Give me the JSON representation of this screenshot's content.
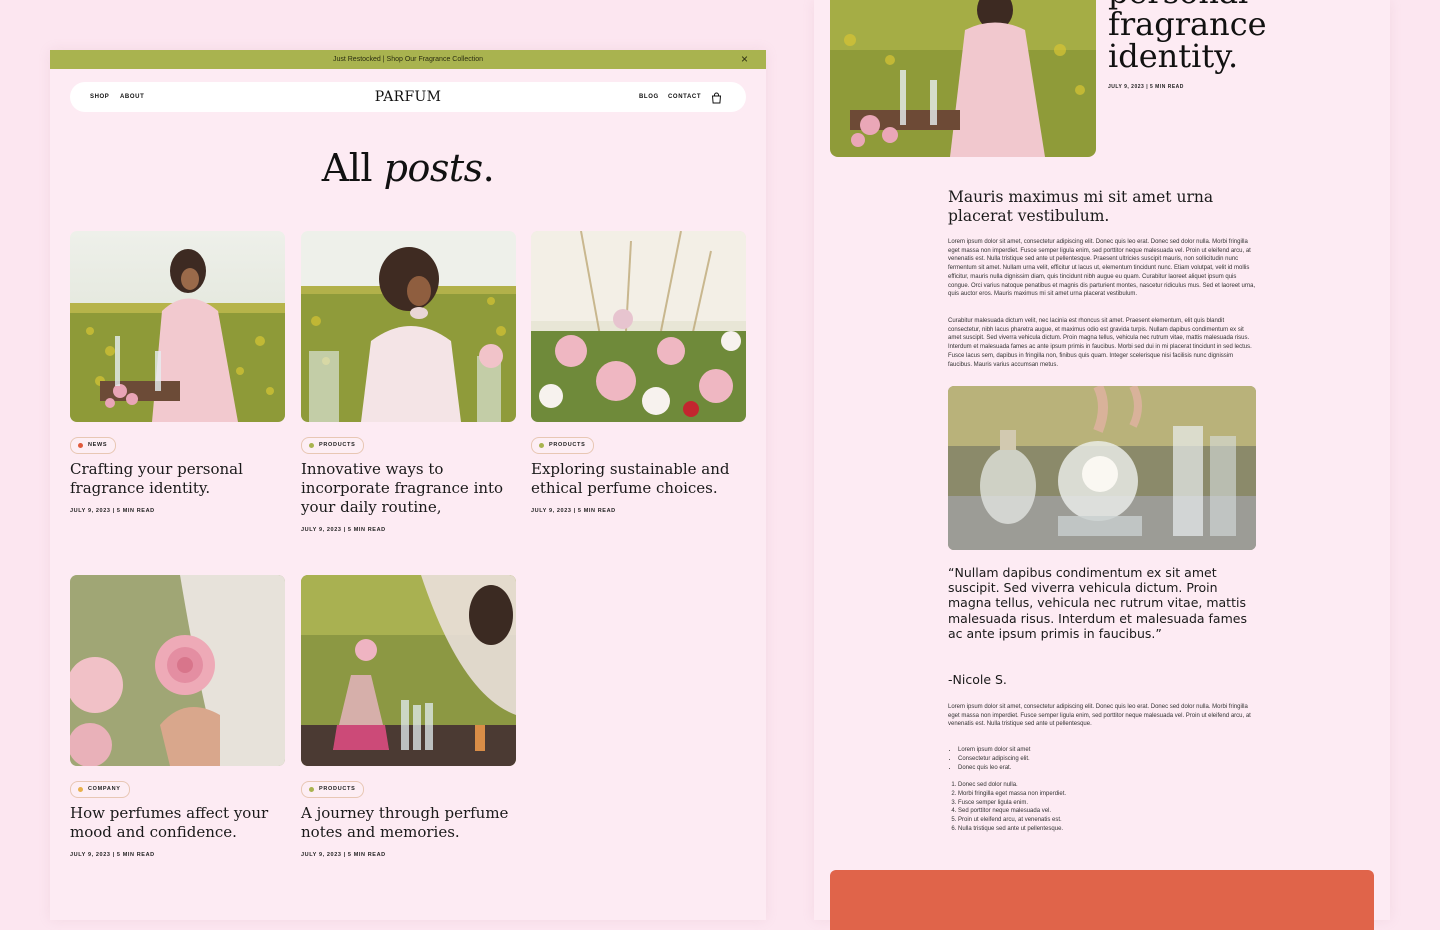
{
  "announcement": {
    "text": "Just Restocked | Shop Our Fragrance Collection",
    "close_icon": "×"
  },
  "nav": {
    "shop": "SHOP",
    "about": "ABOUT",
    "logo": "PARFUM",
    "blog": "BLOG",
    "contact": "CONTACT",
    "cart_icon": "shopping-bag"
  },
  "page_title": {
    "regular": "All ",
    "italic": "posts",
    "end": "."
  },
  "posts": [
    {
      "tag": "NEWS",
      "tag_color": "#e05a3c",
      "title": "Crafting your personal fragrance identity.",
      "meta": "JULY 9, 2023 | 5 MIN READ"
    },
    {
      "tag": "PRODUCTS",
      "tag_color": "#a9b34f",
      "title": "Innovative ways to incorporate fragrance into your daily routine,",
      "meta": "JULY 9, 2023 | 5 MIN READ"
    },
    {
      "tag": "PRODUCTS",
      "tag_color": "#a9b34f",
      "title": "Exploring sustainable and ethical perfume choices.",
      "meta": "JULY 9, 2023 | 5 MIN READ"
    },
    {
      "tag": "COMPANY",
      "tag_color": "#e8b04a",
      "title": "How perfumes affect your mood and confidence.",
      "meta": "JULY 9, 2023 | 5 MIN READ"
    },
    {
      "tag": "PRODUCTS",
      "tag_color": "#a9b34f",
      "title": "A journey through perfume notes and memories.",
      "meta": "JULY 9, 2023 | 5 MIN READ"
    }
  ],
  "article": {
    "title": "personal fragrance identity.",
    "meta": "JULY 9, 2023 | 5 MIN READ",
    "subheading": "Mauris maximus mi sit amet urna placerat vestibulum.",
    "para1": "Lorem ipsum dolor sit amet, consectetur adipiscing elit. Donec quis leo erat. Donec sed dolor nulla. Morbi fringilla eget massa non imperdiet. Fusce semper ligula enim, sed porttitor neque malesuada vel. Proin ut eleifend arcu, at venenatis est. Nulla tristique sed ante ut pellentesque. Praesent ultricies suscipit mauris, non sollicitudin nunc fermentum sit amet. Nullam urna velit, efficitur ut lacus ut, elementum tincidunt nunc. Etiam volutpat, velit id mollis efficitur, mauris nulla dignissim diam, quis tincidunt nibh augue eu quam. Curabitur laoreet aliquet ipsum quis congue. Orci varius natoque penatibus et magnis dis parturient montes, nascetur ridiculus mus. Sed et laoreet urna, quis auctor eros. Mauris maximus mi sit amet urna placerat vestibulum.",
    "para2": "Curabitur malesuada dictum velit, nec lacinia est rhoncus sit amet. Praesent elementum, elit quis blandit consectetur, nibh lacus pharetra augue, et maximus odio est gravida turpis. Nullam dapibus condimentum ex sit amet suscipit. Sed viverra vehicula dictum. Proin magna tellus, vehicula nec rutrum vitae, mattis malesuada risus. Interdum et malesuada fames ac ante ipsum primis in faucibus. Morbi sed dui in mi placerat tincidunt in sed lectus. Fusce lacus sem, dapibus in fringilla non, finibus quis quam. Integer scelerisque nisi facilisis nunc dignissim faucibus. Mauris varius accumsan metus.",
    "quote": "“Nullam dapibus condimentum ex sit amet suscipit. Sed viverra vehicula dictum. Proin magna tellus, vehicula nec rutrum vitae, mattis malesuada risus. Interdum et malesuada fames ac ante ipsum primis in faucibus.”",
    "quote_author": "-Nicole S.",
    "para3": "Lorem ipsum dolor sit amet, consectetur adipiscing elit. Donec quis leo erat. Donec sed dolor nulla. Morbi fringilla eget massa non imperdiet. Fusce semper ligula enim, sed porttitor neque malesuada vel. Proin ut eleifend arcu, at venenatis est. Nulla tristique sed ante ut pellentesque.",
    "bullets": [
      "Lorem ipsum dolor sit amet",
      "Consectetur adipiscing elit.",
      "Donec quis leo erat."
    ],
    "numbered": [
      "Donec sed dolor nulla.",
      "Morbi fringilla eget massa non imperdiet.",
      "Fusce semper ligula enim.",
      "Sed porttitor neque malesuada vel.",
      "Proin ut eleifend arcu, at venenatis est.",
      "Nulla tristique sed ante ut pellentesque."
    ]
  },
  "colors": {
    "accent_green": "#a9b34f",
    "accent_orange": "#e0644a",
    "background": "#fce6f0"
  }
}
